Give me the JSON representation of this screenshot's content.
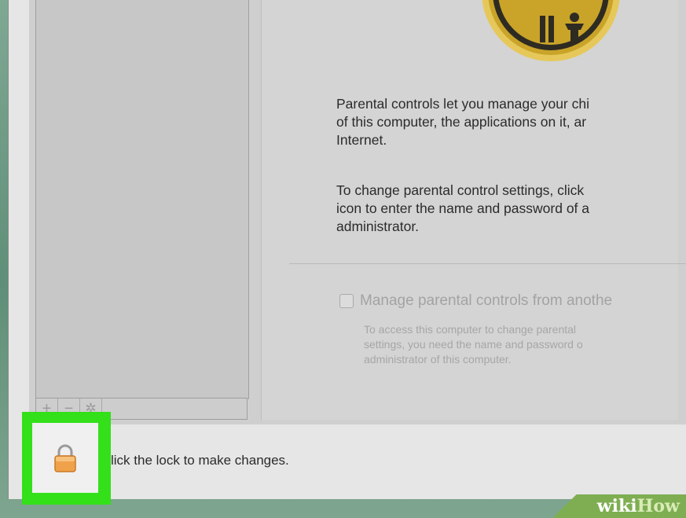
{
  "window": {
    "description_text_1": "Parental controls let you manage your chi\nof this computer, the applications on it, ar\nInternet.",
    "description_text_2": "To change parental control settings, click\nicon to enter the name and password of a\nadministrator.",
    "checkbox_label": "Manage parental controls from anothe",
    "checkbox_checked": false,
    "checkbox_note": "To access this computer to change parental\nsettings, you need the name and password o\nadministrator of this computer.",
    "footer_text": "lick the lock to make changes."
  },
  "sidebar_toolbar": {
    "add_label": "+",
    "remove_label": "−",
    "gear_label": "✲"
  },
  "colors": {
    "highlight": "#33e01a",
    "icon_gold": "#c9a429",
    "lock_orange": "#f0a24b"
  },
  "icons": {
    "parental_controls": "parental-controls-icon",
    "lock": "lock-icon",
    "gear": "gear-icon"
  },
  "watermark": {
    "brand_part1": "wiki",
    "brand_part2": "How"
  }
}
